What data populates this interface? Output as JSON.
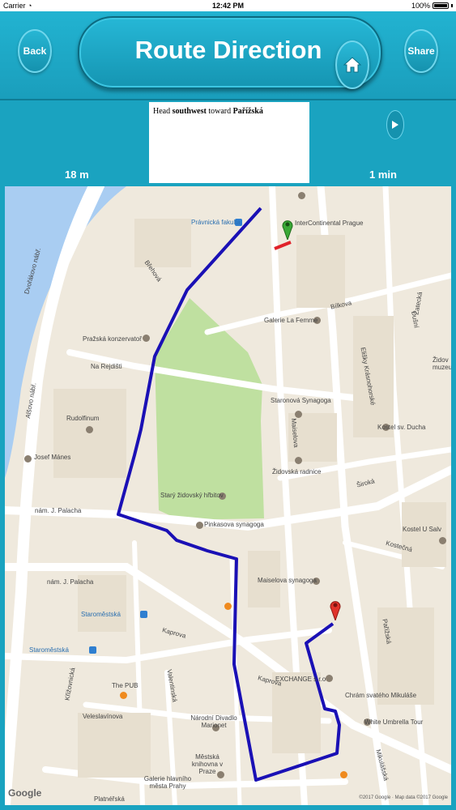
{
  "status_bar": {
    "carrier": "Carrier",
    "time": "12:42 PM",
    "battery": "100%"
  },
  "header": {
    "back_label": "Back",
    "title": "Route Direction",
    "share_label": "Share",
    "home_icon": "home-icon"
  },
  "direction": {
    "instruction_prefix": "Head ",
    "instruction_bold1": "southwest",
    "instruction_mid": " toward ",
    "instruction_bold2": "Pařížská",
    "distance": "18 m",
    "duration": "1 min",
    "next_icon": "play-icon"
  },
  "map": {
    "labels": [
      {
        "text": "Právnická fakulta",
        "key": "pravnicka"
      },
      {
        "text": "InterContinental Prague",
        "key": "intercontinental"
      },
      {
        "text": "Břehová",
        "key": "brehova"
      },
      {
        "text": "Dvořákovo nábř.",
        "key": "dvorakovo"
      },
      {
        "text": "Galerie La Femme",
        "key": "galerie-femme"
      },
      {
        "text": "Bílkova",
        "key": "bilkova"
      },
      {
        "text": "Pražská konzervatoř",
        "key": "konzervator"
      },
      {
        "text": "Na Rejdišti",
        "key": "rejdisti"
      },
      {
        "text": "Rudolfinum",
        "key": "rudolfinum"
      },
      {
        "text": "Staronová Synagoga",
        "key": "staronova"
      },
      {
        "text": "Kostel sv. Ducha",
        "key": "ducha"
      },
      {
        "text": "Josef Mánes",
        "key": "manes"
      },
      {
        "text": "Židovská radnice",
        "key": "radnice"
      },
      {
        "text": "Starý židovský hřbitov",
        "key": "hrbitov"
      },
      {
        "text": "Pinkasova synagoga",
        "key": "pinkasova"
      },
      {
        "text": "nám. J. Palacha",
        "key": "palacha1"
      },
      {
        "text": "Kostel U Salv",
        "key": "salv"
      },
      {
        "text": "Maiselova synagoga",
        "key": "maiselova"
      },
      {
        "text": "nám. J. Palacha",
        "key": "palacha2"
      },
      {
        "text": "Staroměstská",
        "key": "staromestska1"
      },
      {
        "text": "Staroměstská",
        "key": "staromestska2"
      },
      {
        "text": "Kaprova",
        "key": "kaprova1"
      },
      {
        "text": "Kaprova",
        "key": "kaprova2"
      },
      {
        "text": "EXCHANGE s.r.o",
        "key": "exchange"
      },
      {
        "text": "The PUB",
        "key": "pub"
      },
      {
        "text": "Chrám svatého Mikuláše",
        "key": "mikulase"
      },
      {
        "text": "Národní Divadlo Marionet",
        "key": "divadlo"
      },
      {
        "text": "White Umbrella Tour",
        "key": "umbrella"
      },
      {
        "text": "Veleslavínova",
        "key": "veleslavinova"
      },
      {
        "text": "Městská knihovna v Praze",
        "key": "knihovna"
      },
      {
        "text": "Galerie hlavního města Prahy",
        "key": "galerie-prahy"
      },
      {
        "text": "Pařížská",
        "key": "parizska"
      },
      {
        "text": "Široká",
        "key": "siroka"
      },
      {
        "text": "Maiselova",
        "key": "maiselova-st"
      },
      {
        "text": "Žatecká",
        "key": "zatecka"
      },
      {
        "text": "Židov muzeum",
        "key": "zidov"
      },
      {
        "text": "Křižovnická",
        "key": "krizovnicka"
      },
      {
        "text": "Valentinská",
        "key": "valentinska"
      },
      {
        "text": "Elišky Krásnohorské",
        "key": "krasnohorske"
      },
      {
        "text": "Dušní",
        "key": "dusni"
      },
      {
        "text": "Kostečná",
        "key": "kostecna"
      },
      {
        "text": "Mikulášská",
        "key": "mikulasska"
      },
      {
        "text": "Alšovo nábř.",
        "key": "alsovo"
      },
      {
        "text": "Platnéřská",
        "key": "platnerska"
      }
    ],
    "google_logo": "Google",
    "copyright": "©2017 Google · Map data ©2017 Google",
    "colors": {
      "route": "#1a10b5",
      "river": "#a9cdf2",
      "park": "#bfe0a0",
      "road": "#ffffff",
      "block": "#efe9dd"
    }
  }
}
